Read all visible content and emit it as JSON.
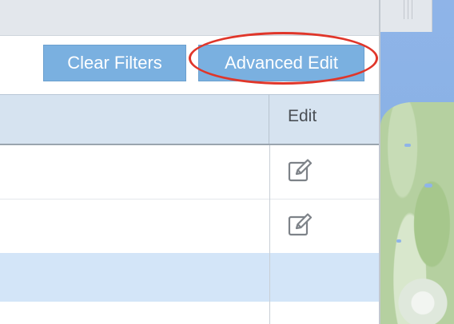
{
  "toolbar": {
    "clear_filters_label": "Clear Filters",
    "advanced_edit_label": "Advanced Edit"
  },
  "table": {
    "columns": [
      "",
      "Edit"
    ],
    "rows": [
      {
        "edit_icon": "pencil-square-icon",
        "selected": false
      },
      {
        "edit_icon": "pencil-square-icon",
        "selected": false
      },
      {
        "edit_icon": null,
        "selected": true
      },
      {
        "edit_icon": null,
        "selected": false
      }
    ]
  },
  "colors": {
    "button_bg": "#7ab0e0",
    "highlight_ring": "#e0362a",
    "header_bg": "#d6e3f0",
    "selected_row_bg": "#d3e5f8"
  }
}
